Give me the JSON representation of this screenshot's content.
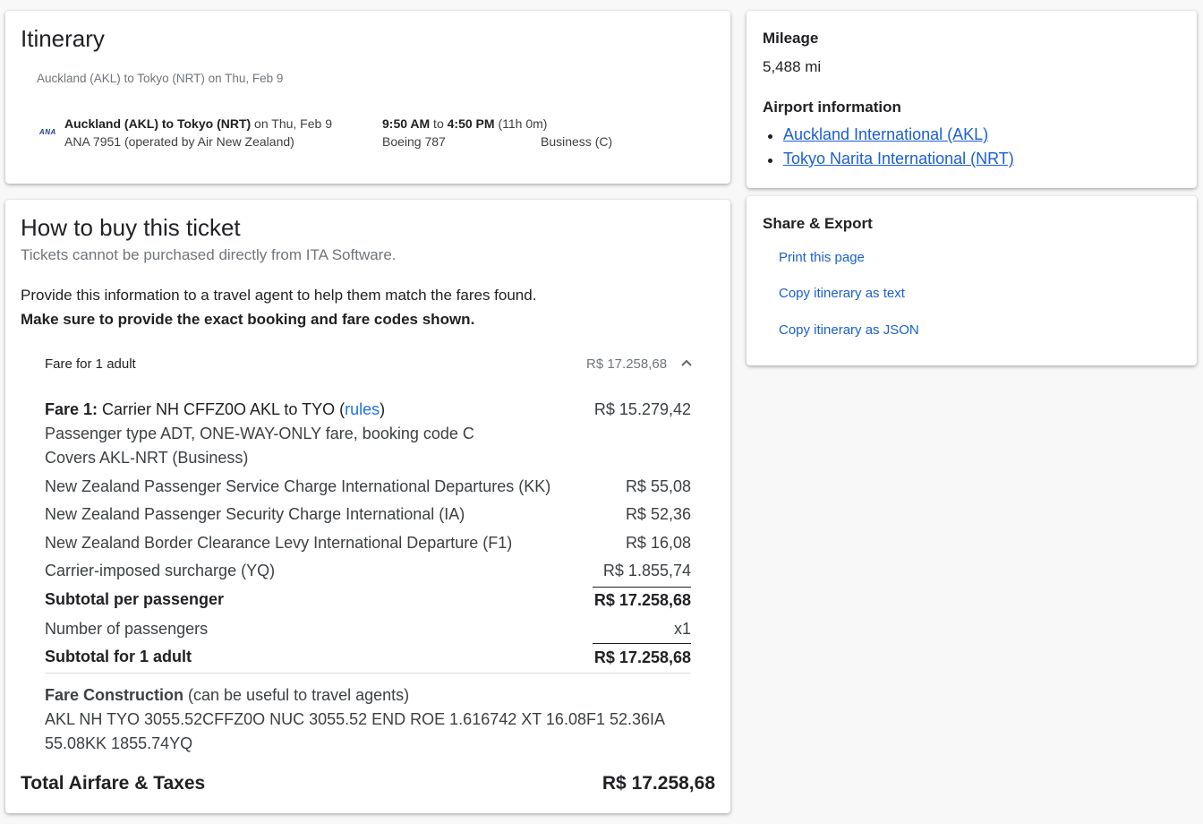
{
  "itinerary": {
    "title": "Itinerary",
    "route_summary": "Auckland (AKL) to Tokyo (NRT) on Thu, Feb 9",
    "segment": {
      "airline_logo": "ANA",
      "route_bold": "Auckland (AKL) to Tokyo (NRT)",
      "date": " on Thu, Feb 9",
      "flight": "ANA 7951 (operated by Air New Zealand)",
      "depart": "9:50 AM",
      "to": " to ",
      "arrive": "4:50 PM",
      "duration": " (11h 0m)",
      "aircraft": "Boeing 787",
      "cabin": "Business (C)"
    }
  },
  "buy": {
    "title": "How to buy this ticket",
    "subtitle": "Tickets cannot be purchased directly from ITA Software.",
    "instruction": "Provide this information to a travel agent to help them match the fares found.",
    "instruction_bold": "Make sure to provide the exact booking and fare codes shown.",
    "fare_header": {
      "label": "Fare for 1 adult",
      "amount": "R$ 17.258,68",
      "toggle_icon": "chevron-up-icon"
    },
    "fare1": {
      "label_bold": "Fare 1:",
      "label_text": " Carrier NH CFFZ0O AKL to TYO (",
      "rules_link": "rules",
      "label_close": ")",
      "amount": "R$ 15.279,42",
      "detail1": "Passenger type ADT, ONE-WAY-ONLY fare, booking code C",
      "detail2": "Covers AKL-NRT (Business)"
    },
    "taxes": [
      {
        "label": "New Zealand Passenger Service Charge International Departures (KK)",
        "amount": "R$ 55,08"
      },
      {
        "label": "New Zealand Passenger Security Charge International (IA)",
        "amount": "R$ 52,36"
      },
      {
        "label": "New Zealand Border Clearance Levy International Departure (F1)",
        "amount": "R$ 16,08"
      },
      {
        "label": "Carrier-imposed surcharge (YQ)",
        "amount": "R$ 1.855,74"
      }
    ],
    "subtotal_per_passenger": {
      "label": "Subtotal per passenger",
      "amount": "R$ 17.258,68"
    },
    "num_passengers": {
      "label": "Number of passengers",
      "value": "x1"
    },
    "subtotal_adult": {
      "label": "Subtotal for 1 adult",
      "amount": "R$ 17.258,68"
    },
    "fare_construction": {
      "label_bold": "Fare Construction",
      "label_note": " (can be useful to travel agents)",
      "line1": "AKL NH TYO 3055.52CFFZ0O NUC 3055.52 END ROE 1.616742 XT 16.08F1 52.36IA",
      "line2": "55.08KK 1855.74YQ"
    },
    "total": {
      "label": "Total Airfare & Taxes",
      "amount": "R$ 17.258,68"
    }
  },
  "mileage": {
    "title": "Mileage",
    "value": "5,488 mi",
    "airport_title": "Airport information",
    "airports": [
      "Auckland International (AKL)",
      "Tokyo Narita International (NRT)"
    ]
  },
  "share": {
    "title": "Share & Export",
    "links": [
      "Print this page",
      "Copy itinerary as text",
      "Copy itinerary as JSON"
    ]
  }
}
